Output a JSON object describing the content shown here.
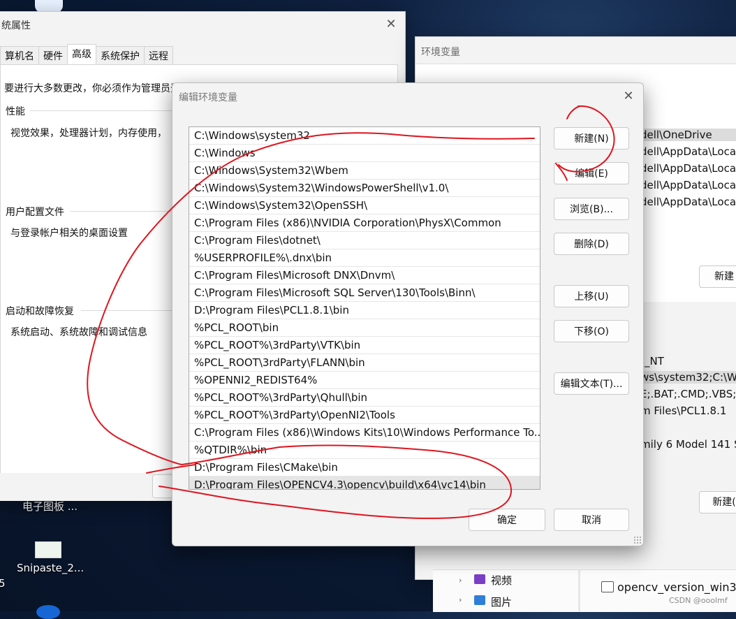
{
  "desktop": {
    "label_1": "电子图板 ...",
    "label_2": "Snipaste_2...",
    "edge_char": "5"
  },
  "system_properties": {
    "title": "统属性",
    "tabs": [
      {
        "label": "算机名"
      },
      {
        "label": "硬件"
      },
      {
        "label": "高级"
      },
      {
        "label": "系统保护"
      },
      {
        "label": "远程"
      }
    ],
    "notice": "要进行大多数更改，你必须作为管理员登录。",
    "groups": [
      {
        "title": "性能",
        "text": "视觉效果，处理器计划，内存使用，"
      },
      {
        "title": "用户配置文件",
        "text": "与登录帐户相关的桌面设置"
      },
      {
        "title": "启动和故障恢复",
        "text": "系统启动、系统故障和调试信息"
      }
    ]
  },
  "env_window": {
    "title": "环境变量",
    "user_rows": [
      "dell\\OneDrive",
      "dell\\AppData\\Loca",
      "dell\\AppData\\Loca",
      "dell\\AppData\\Loca",
      "dell\\AppData\\Loca"
    ],
    "new_label_1": "新建",
    "system_rows": [
      "_NT",
      "ws\\system32;C:\\Wi",
      "E;.BAT;.CMD;.VBS;.V",
      "m Files\\PCL1.8.1",
      "",
      "mily 6 Model 141 S"
    ],
    "new_label_2": "新建("
  },
  "explorer": {
    "item_1": "视频",
    "item_2": "图片",
    "file": "opencv_version_win32.c",
    "watermark": "CSDN @ooolmf"
  },
  "edit_dialog": {
    "title": "编辑环境变量",
    "paths": [
      "C:\\Windows\\system32",
      "C:\\Windows",
      "C:\\Windows\\System32\\Wbem",
      "C:\\Windows\\System32\\WindowsPowerShell\\v1.0\\",
      "C:\\Windows\\System32\\OpenSSH\\",
      "C:\\Program Files (x86)\\NVIDIA Corporation\\PhysX\\Common",
      "C:\\Program Files\\dotnet\\",
      "%USERPROFILE%\\.dnx\\bin",
      "C:\\Program Files\\Microsoft DNX\\Dnvm\\",
      "C:\\Program Files\\Microsoft SQL Server\\130\\Tools\\Binn\\",
      "D:\\Program Files\\PCL1.8.1\\bin",
      "%PCL_ROOT\\bin",
      "%PCL_ROOT%\\3rdParty\\VTK\\bin",
      "%PCL_ROOT\\3rdParty\\FLANN\\bin",
      "%OPENNI2_REDIST64%",
      "%PCL_ROOT%\\3rdParty\\Qhull\\bin",
      "%PCL_ROOT%\\3rdParty\\OpenNI2\\Tools",
      "C:\\Program Files (x86)\\Windows Kits\\10\\Windows Performance To...",
      "%QTDIR%\\bin",
      "D:\\Program Files\\CMake\\bin",
      "D:\\Program Files\\OPENCV4.3\\opencv\\build\\x64\\vc14\\bin"
    ],
    "selected_index": 20,
    "buttons": {
      "new": "新建(N)",
      "edit": "编辑(E)",
      "browse": "浏览(B)...",
      "delete": "删除(D)",
      "move_up": "上移(U)",
      "move_down": "下移(O)",
      "edit_text": "编辑文本(T)...",
      "ok": "确定",
      "cancel": "取消"
    }
  },
  "colors": {
    "annotation": "#e0141e",
    "selection": "#e5e5e5"
  }
}
